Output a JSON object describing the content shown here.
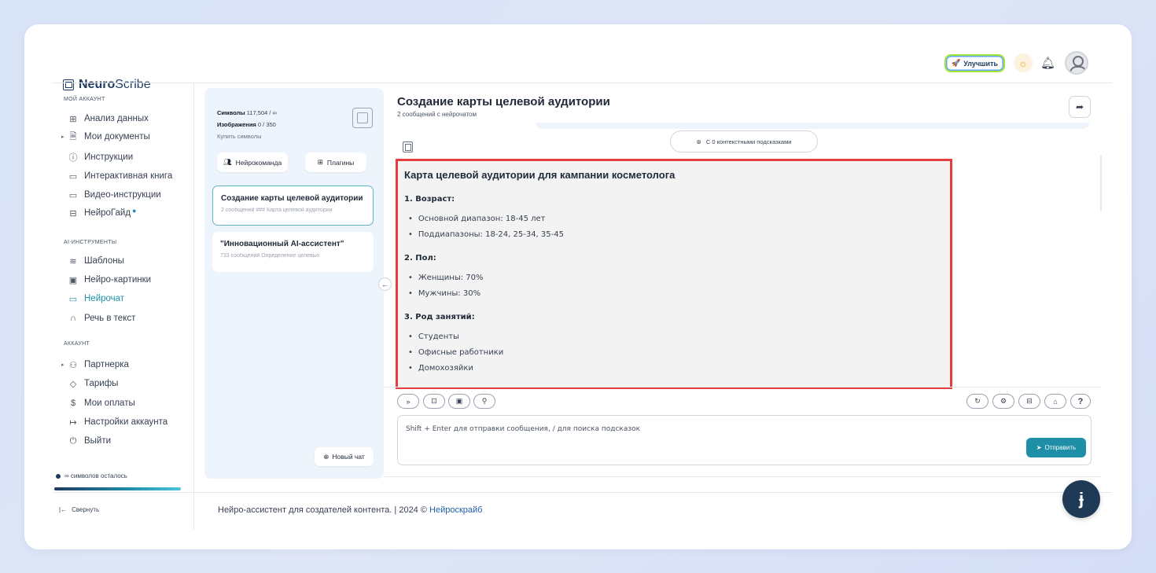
{
  "brand": {
    "name_bold": "Neuro",
    "name_rest": "Scribe"
  },
  "header": {
    "upgrade_label": "Улучшить"
  },
  "sidebar": {
    "section_account": "МОЙ АККАУНТ",
    "account_items": [
      {
        "label": "Анализ данных",
        "icon": "grid-icon"
      },
      {
        "label": "Мои документы",
        "icon": "document-icon"
      },
      {
        "label": "Инструкции",
        "icon": "help-circle-icon"
      },
      {
        "label": "Интерактивная книга",
        "icon": "book-icon"
      },
      {
        "label": "Видео-инструкции",
        "icon": "video-icon"
      },
      {
        "label": "НейроГайд",
        "icon": "layout-icon"
      }
    ],
    "section_ai": "AI-ИНСТРУМЕНТЫ",
    "ai_items": [
      {
        "label": "Шаблоны",
        "icon": "layers-icon"
      },
      {
        "label": "Нейро-картинки",
        "icon": "image-icon"
      },
      {
        "label": "Нейрочат",
        "icon": "chat-icon"
      },
      {
        "label": "Речь в текст",
        "icon": "headphones-icon"
      }
    ],
    "section_acc": "АККАУНТ",
    "acc_items": [
      {
        "label": "Партнерка",
        "icon": "users-icon"
      },
      {
        "label": "Тарифы",
        "icon": "tag-icon"
      },
      {
        "label": "Мои оплаты",
        "icon": "dollar-icon"
      },
      {
        "label": "Настройки аккаунта",
        "icon": "settings-exit-icon"
      },
      {
        "label": "Выйти",
        "icon": "power-icon"
      }
    ],
    "symbols_left": "∞ символов осталось",
    "collapse_label": "Свернуть"
  },
  "chatlist": {
    "symbols_label": "Символы",
    "symbols_value": "117,504 / ∞",
    "images_label": "Изображения",
    "images_value": "0 / 350",
    "buy_label": "Купить символы",
    "team_button": "Нейрокоманда",
    "plugins_button": "Плагины",
    "chats": [
      {
        "title": "Создание карты целевой аудитории",
        "meta": "2 сообщений    ### Карта целевой аудитории"
      },
      {
        "title": "\"Инновационный AI-ассистент\"",
        "meta": "733 сообщений Определение целевых"
      }
    ],
    "new_chat": "Новый чат"
  },
  "chat": {
    "title": "Создание карты целевой аудитории",
    "subtitle": "2 сообщений с нейрочатом",
    "hints_button": "С 0 контекстными подсказками",
    "answer": {
      "heading": "Карта целевой аудитории для кампании косметолога",
      "sections": [
        {
          "title": "1. Возраст:",
          "items": [
            "Основной диапазон: 18-45 лет",
            "Поддиапазоны: 18-24, 25-34, 35-45"
          ]
        },
        {
          "title": "2. Пол:",
          "items": [
            "Женщины: 70%",
            "Мужчины: 30%"
          ]
        },
        {
          "title": "3. Род занятий:",
          "items": [
            "Студенты",
            "Офисные работники",
            "Домохозяйки"
          ]
        }
      ]
    },
    "composer_placeholder": "Shift + Enter для отправки сообщения, / для поиска подсказок",
    "send_label": "Отправить"
  },
  "footer": {
    "text": "Нейро-ассистент для создателей контента.  | 2024 © ",
    "link": "Нейроскрайб"
  },
  "colors": {
    "accent": "#1f8fa8",
    "highlight_border": "#e53e3e",
    "fab": "#1f3a56"
  }
}
